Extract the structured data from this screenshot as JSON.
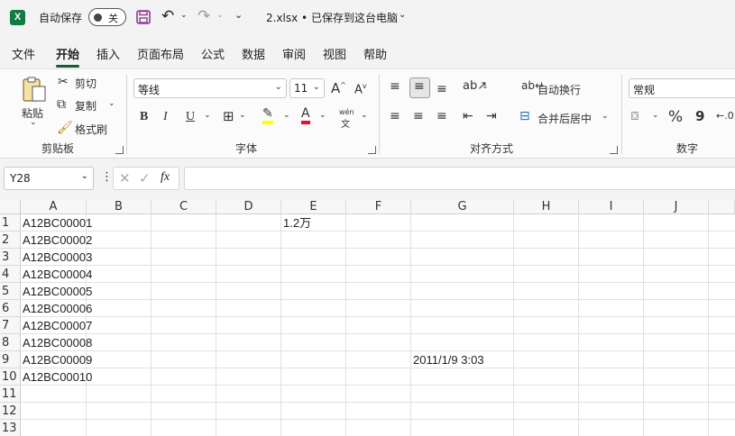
{
  "titlebar": {
    "autosave_label": "自动保存",
    "autosave_state": "关",
    "filename": "2.xlsx • 已保存到这台电脑",
    "icons": [
      "excel-logo-icon",
      "save-icon",
      "undo-icon",
      "redo-icon",
      "customize-icon"
    ]
  },
  "tabs": [
    "文件",
    "开始",
    "插入",
    "页面布局",
    "公式",
    "数据",
    "审阅",
    "视图",
    "帮助"
  ],
  "active_tab": "开始",
  "ribbon": {
    "clipboard": {
      "title": "剪贴板",
      "paste": "粘贴",
      "cut": "剪切",
      "copy": "复制",
      "format_painter": "格式刷"
    },
    "font": {
      "title": "字体",
      "font_name": "等线",
      "font_size": "11",
      "bold": "B",
      "italic": "I",
      "underline": "U",
      "font_color": "A",
      "phonetic": "wén"
    },
    "alignment": {
      "title": "对齐方式",
      "wrap_text": "自动换行",
      "merge_center": "合并后居中"
    },
    "number": {
      "title": "数字",
      "format": "常规",
      "percent": "%",
      "comma": "9"
    }
  },
  "formula_bar": {
    "name_box": "Y28",
    "fx": "fx",
    "content": ""
  },
  "grid": {
    "columns": [
      "A",
      "B",
      "C",
      "D",
      "E",
      "F",
      "G",
      "H",
      "I",
      "J"
    ],
    "rows": [
      "1",
      "2",
      "3",
      "4",
      "5",
      "6",
      "7",
      "8",
      "9",
      "10",
      "11",
      "12",
      "13"
    ],
    "cells": [
      {
        "ref": "A1",
        "value": "A12BC00001"
      },
      {
        "ref": "A2",
        "value": "A12BC00002"
      },
      {
        "ref": "A3",
        "value": "A12BC00003"
      },
      {
        "ref": "A4",
        "value": "A12BC00004"
      },
      {
        "ref": "A5",
        "value": "A12BC00005"
      },
      {
        "ref": "A6",
        "value": "A12BC00006"
      },
      {
        "ref": "A7",
        "value": "A12BC00007"
      },
      {
        "ref": "A8",
        "value": "A12BC00008"
      },
      {
        "ref": "A9",
        "value": "A12BC00009"
      },
      {
        "ref": "A10",
        "value": "A12BC00010"
      },
      {
        "ref": "E1",
        "value": "1.2万"
      },
      {
        "ref": "G9",
        "value": "2011/1/9 3:03"
      }
    ]
  },
  "colors": {
    "excel_green": "#107c41",
    "tab_underline": "#185c37",
    "save_purple": "#8b3a8f",
    "highlight_yellow": "#ffff00",
    "font_red": "#e81123"
  }
}
